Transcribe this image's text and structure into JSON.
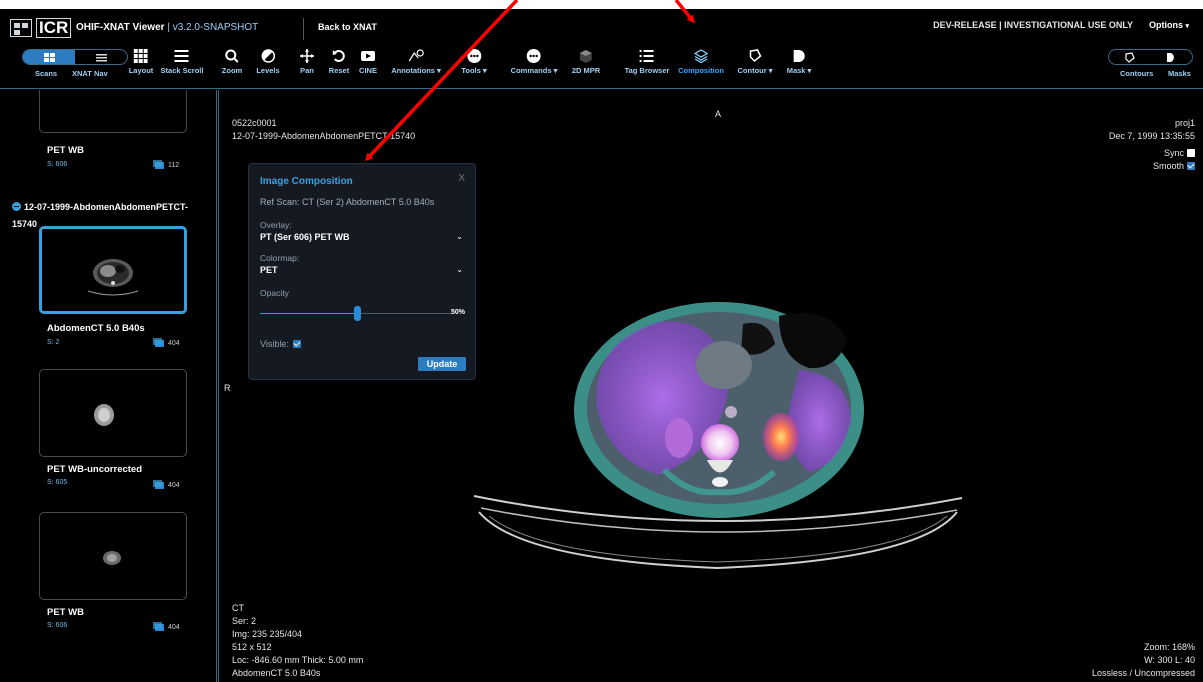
{
  "header": {
    "logo_text": "ICR",
    "app_name": "OHIF-XNAT Viewer",
    "version": "| v3.2.0-SNAPSHOT",
    "back_link": "Back to XNAT",
    "release_notice": "DEV-RELEASE | INVESTIGATIONAL USE ONLY",
    "options_label": "Options"
  },
  "toolbar": {
    "scans_label": "Scans",
    "xnatnav_label": "XNAT Nav",
    "tools": [
      {
        "label": "Layout",
        "icon": "grid-icon"
      },
      {
        "label": "Stack Scroll",
        "icon": "bars-icon"
      },
      {
        "label": "Zoom",
        "icon": "search-icon"
      },
      {
        "label": "Levels",
        "icon": "contrast-icon"
      },
      {
        "label": "Pan",
        "icon": "move-icon"
      },
      {
        "label": "Reset",
        "icon": "reset-icon"
      },
      {
        "label": "CINE",
        "icon": "youtube-icon"
      },
      {
        "label": "Annotations ▾",
        "icon": "annotations-icon"
      },
      {
        "label": "Tools ▾",
        "icon": "more-icon"
      },
      {
        "label": "Commands ▾",
        "icon": "more-icon"
      },
      {
        "label": "2D MPR",
        "icon": "cube-icon"
      },
      {
        "label": "Tag Browser",
        "icon": "list-icon"
      },
      {
        "label": "Composition",
        "icon": "layers-icon"
      },
      {
        "label": "Contour ▾",
        "icon": "contour-icon"
      },
      {
        "label": "Mask ▾",
        "icon": "mask-icon"
      }
    ],
    "contours_label": "Contours",
    "masks_label": "Masks"
  },
  "sidebar": {
    "series_top": {
      "description": "PET WB",
      "number": "S: 606",
      "count": "112"
    },
    "study_title": "12-07-1999-AbdomenAbdomenPETCT-15740",
    "series": [
      {
        "description": "AbdomenCT 5.0 B40s",
        "number": "S: 2",
        "count": "404",
        "selected": true
      },
      {
        "description": "PET WB-uncorrected",
        "number": "S: 605",
        "count": "404",
        "selected": false
      },
      {
        "description": "PET WB",
        "number": "S: 606",
        "count": "404",
        "selected": false
      }
    ]
  },
  "viewport": {
    "orientation_top": "A",
    "orientation_left": "R",
    "patient_id": "0522c0001",
    "study_desc": "12-07-1999-AbdomenAbdomenPETCT-15740",
    "project": "proj1",
    "study_date": "Dec 7, 1999 13:35:55",
    "sync_label": "Sync",
    "sync_checked": false,
    "smooth_label": "Smooth",
    "smooth_checked": true,
    "modality": "CT",
    "series": "Ser: 2",
    "image": "Img: 235 235/404",
    "matrix": "512 x 512",
    "location": "Loc: -846.60 mm Thick: 5.00 mm",
    "series_desc": "AbdomenCT 5.0 B40s",
    "zoom": "Zoom: 168%",
    "window_level": "W: 300 L: 40",
    "compression": "Lossless / Uncompressed"
  },
  "composition_panel": {
    "title": "Image Composition",
    "close": "X",
    "ref_scan": "Ref Scan:  CT (Ser 2) AbdomenCT 5.0 B40s",
    "overlay_label": "Overlay:",
    "overlay_value": "PT (Ser 606) PET WB",
    "colormap_label": "Colormap:",
    "colormap_value": "PET",
    "opacity_label": "Opacity",
    "opacity_value": 0.5,
    "opacity_text": "50%",
    "visible_label": "Visible:",
    "visible_checked": true,
    "update_label": "Update"
  },
  "colors": {
    "accent": "#3aa0dc",
    "button": "#2b7dbf",
    "annotation_arrow": "#ff0000"
  }
}
